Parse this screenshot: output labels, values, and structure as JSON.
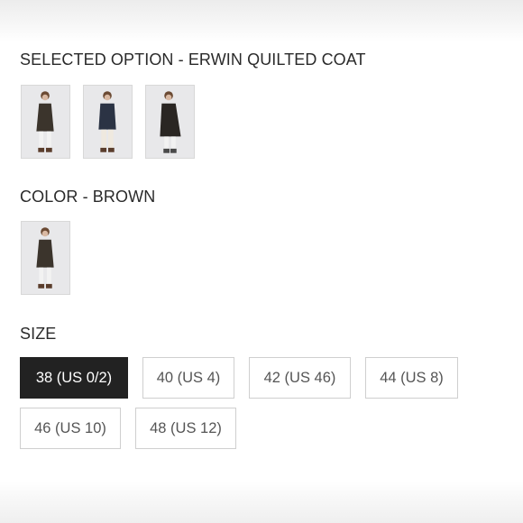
{
  "selected_option": {
    "heading": "SELECTED OPTION - ERWIN QUILTED COAT",
    "thumbnails": [
      {
        "name": "coat-photo-brown",
        "coat_color": "#3b342c"
      },
      {
        "name": "coat-photo-navy",
        "coat_color": "#2b3344"
      },
      {
        "name": "coat-photo-dark",
        "coat_color": "#2a2623"
      }
    ]
  },
  "color": {
    "heading": "COLOR - BROWN",
    "swatches": [
      {
        "name": "color-swatch-brown",
        "coat_color": "#3b342c",
        "selected": true
      }
    ]
  },
  "size": {
    "heading": "SIZE",
    "options": [
      {
        "label": "38 (US 0/2)",
        "selected": true
      },
      {
        "label": "40 (US 4)",
        "selected": false
      },
      {
        "label": "42 (US 46)",
        "selected": false
      },
      {
        "label": "44 (US 8)",
        "selected": false
      },
      {
        "label": "46 (US 10)",
        "selected": false
      },
      {
        "label": "48 (US 12)",
        "selected": false
      }
    ]
  }
}
